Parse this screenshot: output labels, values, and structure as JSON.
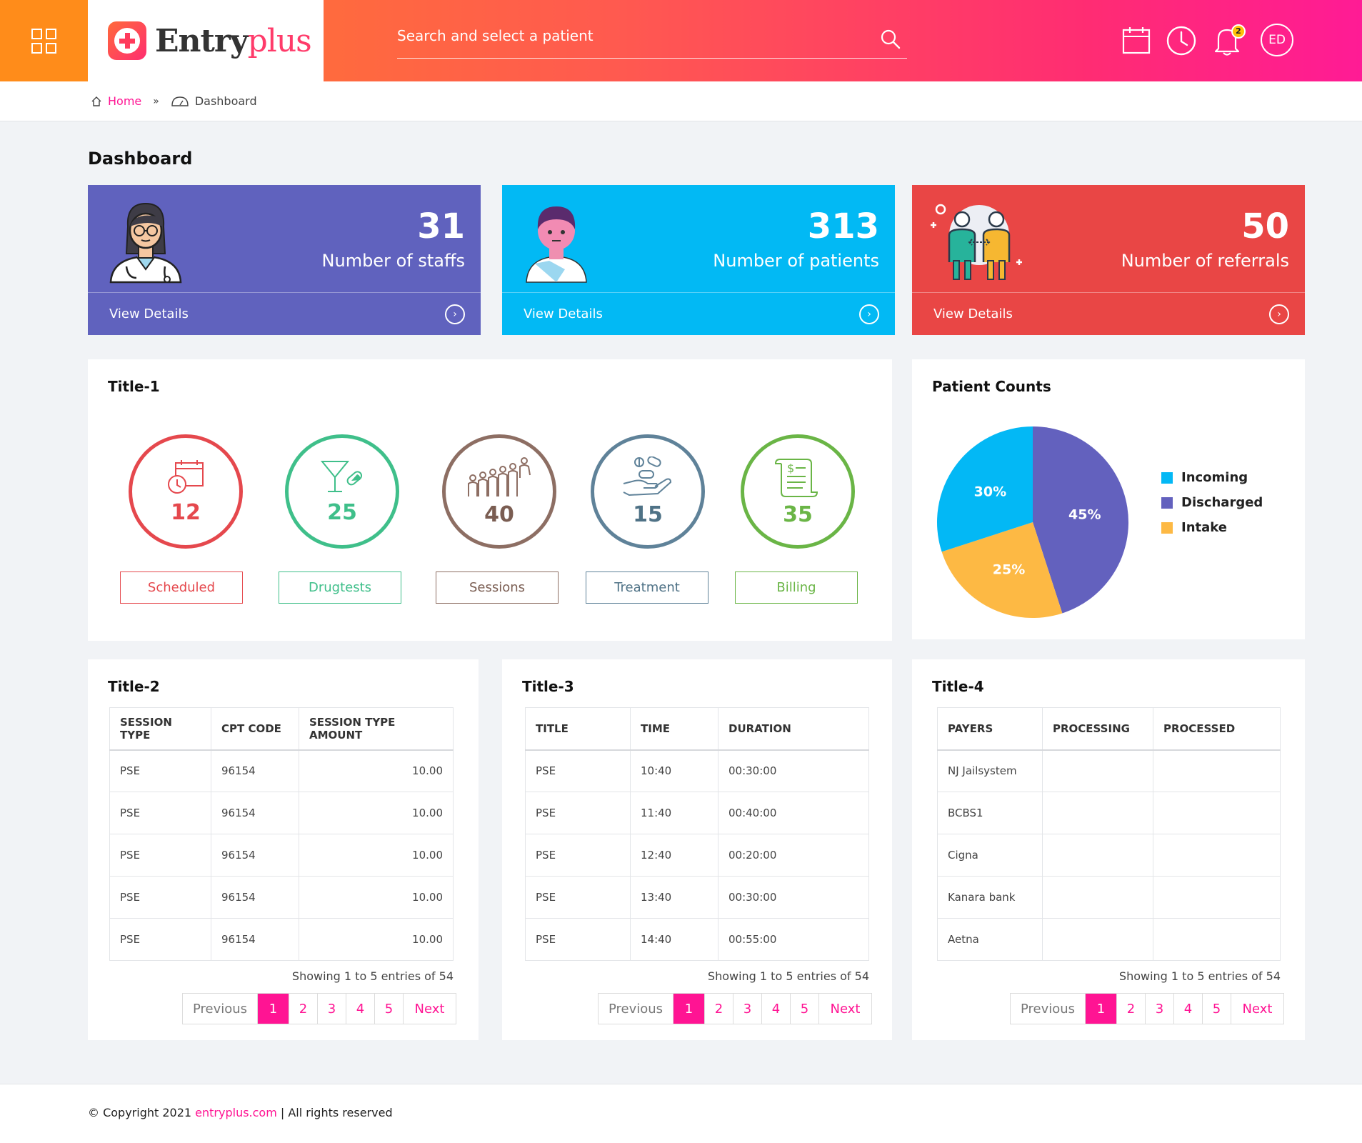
{
  "header": {
    "logo_part1": "Entry",
    "logo_part2": "plus",
    "search_placeholder": "Search and select a patient",
    "notification_count": "2",
    "user_initials": "ED"
  },
  "breadcrumb": {
    "home": "Home",
    "separator": "»",
    "current": "Dashboard"
  },
  "page_title": "Dashboard",
  "stats": [
    {
      "value": "31",
      "label": "Number of staffs",
      "link": "View Details",
      "color": "#6062be"
    },
    {
      "value": "313",
      "label": "Number of patients",
      "link": "View Details",
      "color": "#02b9f4"
    },
    {
      "value": "50",
      "label": "Number of referrals",
      "link": "View Details",
      "color": "#e94645"
    }
  ],
  "title1": {
    "heading": "Title-1",
    "items": [
      {
        "value": "12",
        "label": "Scheduled",
        "color": "#e5484d",
        "icon": "calendar-clock-icon"
      },
      {
        "value": "25",
        "label": "Drugtests",
        "color": "#3fbf8a",
        "icon": "cocktail-pill-icon"
      },
      {
        "value": "40",
        "label": "Sessions",
        "color": "#8d6e63",
        "icon": "group-people-icon"
      },
      {
        "value": "15",
        "label": "Treatment",
        "color": "#5f8299",
        "icon": "hand-pills-icon"
      },
      {
        "value": "35",
        "label": "Billing",
        "color": "#6ab546",
        "icon": "invoice-scroll-icon"
      }
    ]
  },
  "patient_counts": {
    "heading": "Patient Counts",
    "chart_data": {
      "type": "pie",
      "categories": [
        "Incoming",
        "Discharged",
        "Intake"
      ],
      "values": [
        30,
        45,
        25
      ],
      "labels": [
        "30%",
        "45%",
        "25%"
      ],
      "colors": [
        "#03b8f5",
        "#6361be",
        "#fdb944"
      ],
      "legend_position": "right"
    }
  },
  "title2": {
    "heading": "Title-2",
    "columns": [
      "SESSION TYPE",
      "CPT CODE",
      "SESSION TYPE AMOUNT"
    ],
    "rows": [
      [
        "PSE",
        "96154",
        "10.00"
      ],
      [
        "PSE",
        "96154",
        "10.00"
      ],
      [
        "PSE",
        "96154",
        "10.00"
      ],
      [
        "PSE",
        "96154",
        "10.00"
      ],
      [
        "PSE",
        "96154",
        "10.00"
      ]
    ],
    "showing": "Showing 1 to 5 entries of 54"
  },
  "title3": {
    "heading": "Title-3",
    "columns": [
      "TITLE",
      "TIME",
      "DURATION"
    ],
    "rows": [
      [
        "PSE",
        "10:40",
        "00:30:00"
      ],
      [
        "PSE",
        "11:40",
        "00:40:00"
      ],
      [
        "PSE",
        "12:40",
        "00:20:00"
      ],
      [
        "PSE",
        "13:40",
        "00:30:00"
      ],
      [
        "PSE",
        "14:40",
        "00:55:00"
      ]
    ],
    "showing": "Showing 1 to 5 entries of 54"
  },
  "title4": {
    "heading": "Title-4",
    "columns": [
      "PAYERS",
      "PROCESSING",
      "PROCESSED"
    ],
    "rows": [
      [
        "NJ Jailsystem",
        "",
        ""
      ],
      [
        "BCBS1",
        "",
        ""
      ],
      [
        "Cigna",
        "",
        ""
      ],
      [
        "Kanara bank",
        "",
        ""
      ],
      [
        "Aetna",
        "",
        ""
      ]
    ],
    "showing": "Showing 1 to 5 entries of 54"
  },
  "pagination": {
    "previous": "Previous",
    "pages": [
      "1",
      "2",
      "3",
      "4",
      "5"
    ],
    "next": "Next",
    "active": "1"
  },
  "footer": {
    "prefix": "© Copyright 2021 ",
    "link": "entryplus.com",
    "suffix": " | All rights reserved"
  }
}
